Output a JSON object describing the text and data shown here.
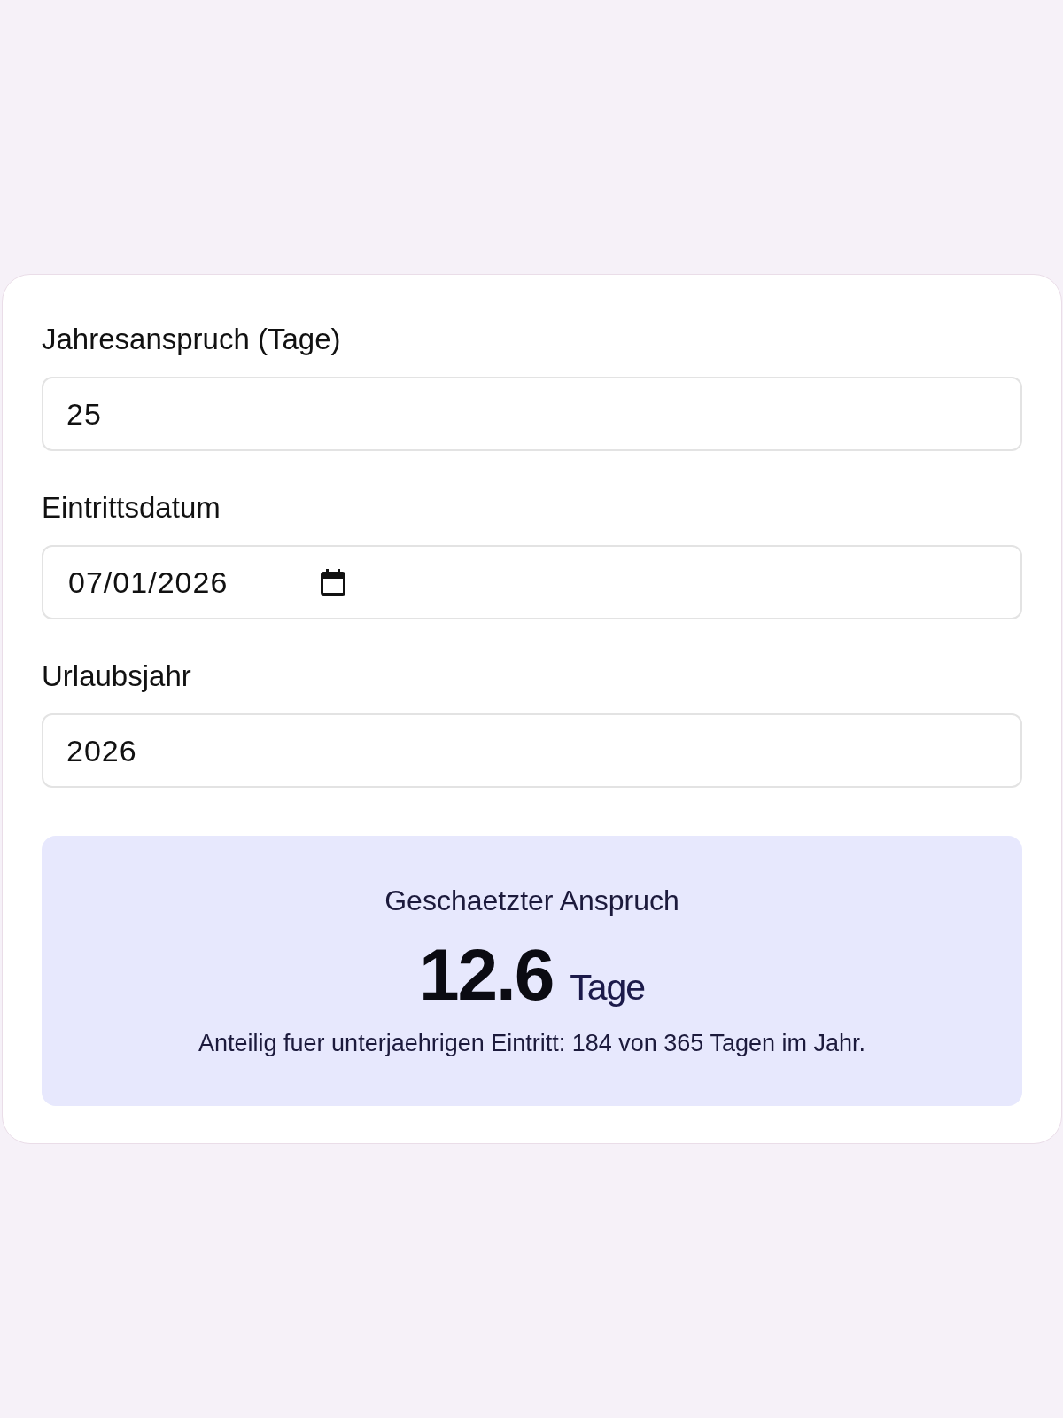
{
  "fields": [
    {
      "kind": "number",
      "label": "Jahresanspruch (Tage)",
      "value": "25"
    },
    {
      "kind": "date",
      "label": "Eintrittsdatum",
      "value": "07/01/2026"
    },
    {
      "kind": "number",
      "label": "Urlaubsjahr",
      "value": "2026"
    }
  ],
  "result": {
    "title": "Geschaetzter Anspruch",
    "value": "12.6",
    "unit": "Tage",
    "note": "Anteilig fuer unterjaehrigen Eintritt: 184 von 365 Tagen im Jahr."
  }
}
